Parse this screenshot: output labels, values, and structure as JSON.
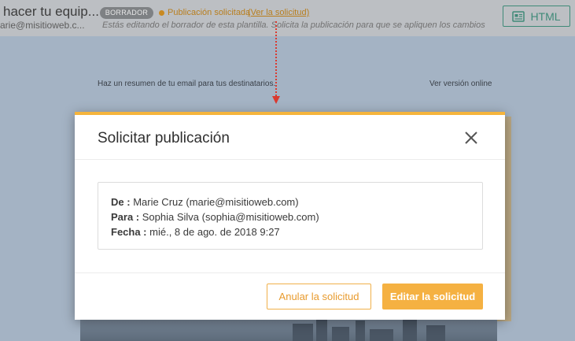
{
  "header": {
    "title": "hacer tu equip...",
    "email": "arie@misitioweb.c...",
    "badge": "BORRADOR",
    "status": "Publicación solicitada",
    "status_link": "(Ver la solicitud)",
    "note": "Estás editando el borrador de esta plantilla. Solicita la publicación para que se apliquen los cambios e",
    "html_button": "HTML",
    "status_color": "#c98a22",
    "accent_color": "#3f8a78"
  },
  "preview": {
    "summary_text": "Haz un resumen de tu email para tus destinatarios.",
    "online_link": "Ver versión online"
  },
  "modal": {
    "title": "Solicitar publicación",
    "from_label": "De :",
    "from_value": "Marie Cruz (marie@misitioweb.com)",
    "to_label": "Para :",
    "to_value": "Sophia Silva (sophia@misitioweb.com)",
    "date_label": "Fecha :",
    "date_value": "mié., 8 de ago. de 2018 9:27",
    "cancel_button": "Anular la solicitud",
    "edit_button": "Editar la solicitud",
    "accent_color": "#f5b43c"
  },
  "icons": {
    "close": "close-icon",
    "html": "html-document-icon",
    "status": "status-dot-icon"
  }
}
